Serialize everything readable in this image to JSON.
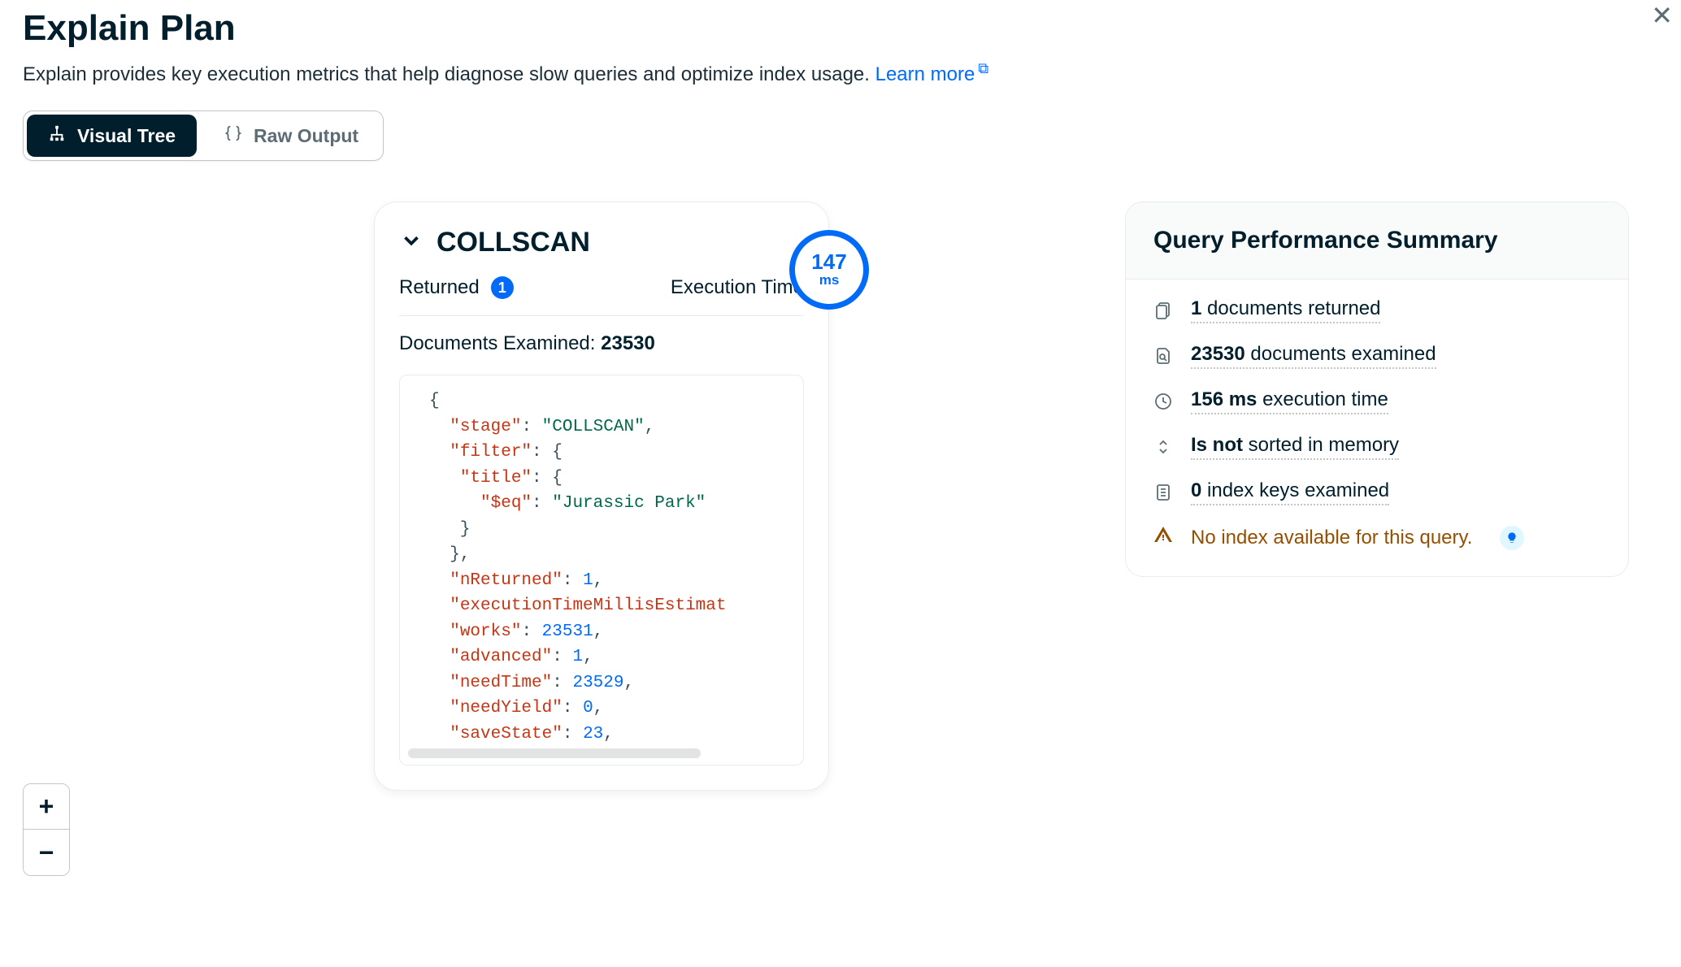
{
  "header": {
    "title": "Explain Plan",
    "subtitle": "Explain provides key execution metrics that help diagnose slow queries and optimize index usage.",
    "learn_more": "Learn more"
  },
  "tabs": {
    "visual_tree": "Visual Tree",
    "raw_output": "Raw Output"
  },
  "stage": {
    "name": "COLLSCAN",
    "returned_label": "Returned",
    "returned_count": "1",
    "exec_time_label": "Execution Time",
    "exec_time_value": "147",
    "exec_time_unit": "ms",
    "docs_examined_label": "Documents Examined:",
    "docs_examined_value": "23530",
    "json": {
      "stage_key": "\"stage\"",
      "stage_val": "\"COLLSCAN\"",
      "filter_key": "\"filter\"",
      "title_key": "\"title\"",
      "eq_key": "\"$eq\"",
      "eq_val": "\"Jurassic Park\"",
      "nreturned_key": "\"nReturned\"",
      "nreturned_val": "1",
      "etme_key": "\"executionTimeMillisEstimat",
      "works_key": "\"works\"",
      "works_val": "23531",
      "advanced_key": "\"advanced\"",
      "advanced_val": "1",
      "needtime_key": "\"needTime\"",
      "needtime_val": "23529",
      "needyield_key": "\"needYield\"",
      "needyield_val": "0",
      "savestate_key": "\"saveState\"",
      "savestate_val": "23"
    }
  },
  "summary": {
    "title": "Query Performance Summary",
    "docs_returned_bold": "1",
    "docs_returned_rest": " documents returned",
    "docs_examined_bold": "23530",
    "docs_examined_rest": " documents examined",
    "exec_time_bold": "156 ms",
    "exec_time_rest": " execution time",
    "sorted_bold": "Is not",
    "sorted_rest": " sorted in memory",
    "index_keys_bold": "0",
    "index_keys_rest": " index keys examined",
    "warning": "No index available for this query."
  },
  "zoom": {
    "in": "+",
    "out": "−"
  }
}
